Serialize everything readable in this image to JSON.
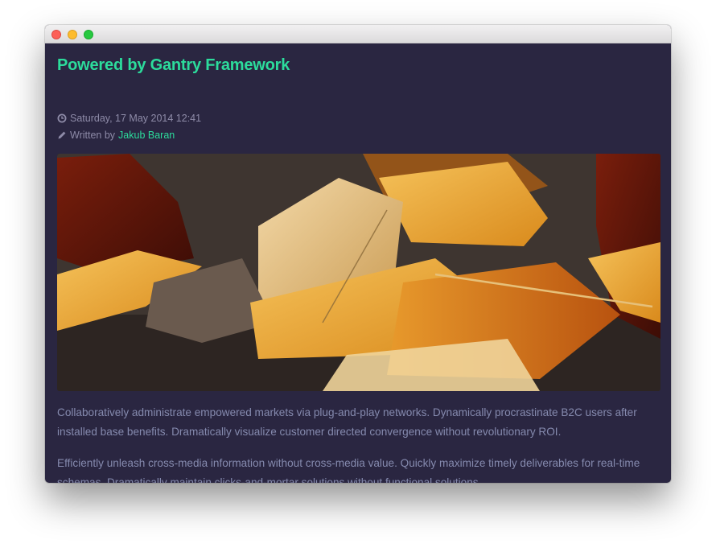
{
  "window": {
    "controls": [
      "close",
      "minimize",
      "zoom"
    ]
  },
  "article": {
    "title": "Powered by Gantry Framework",
    "date": "Saturday, 17 May 2014 12:41",
    "written_by_label": "Written by",
    "author": "Jakub Baran",
    "image": {
      "subject": "autumn leaves on pavement"
    },
    "paragraphs": [
      "Collaboratively administrate empowered markets via plug-and-play networks. Dynamically procrastinate B2C users after installed base benefits. Dramatically visualize customer directed convergence without revolutionary ROI.",
      "Efficiently unleash cross-media information without cross-media value. Quickly maximize timely deliverables for real-time schemas. Dramatically maintain clicks-and-mortar solutions without functional solutions."
    ]
  },
  "icons": {
    "date": "clock-icon",
    "author": "pencil-icon"
  },
  "colors": {
    "background": "#2a2641",
    "accent": "#2cdc9c",
    "muted_text": "#8e8ba8",
    "body_text": "#858aae"
  }
}
